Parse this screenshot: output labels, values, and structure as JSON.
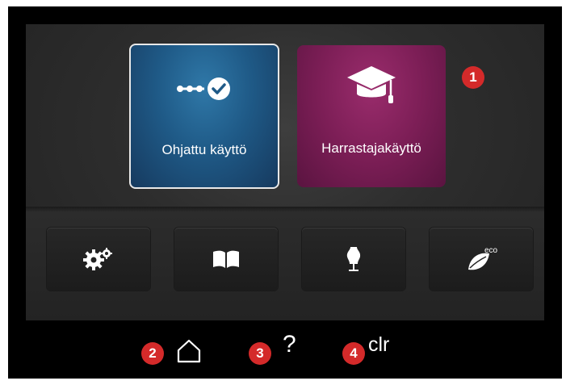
{
  "home": {
    "tiles": [
      {
        "label": "Ohjattu käyttö",
        "icon": "guided-path-check-icon",
        "selected": true
      },
      {
        "label": "Harrastajakäyttö",
        "icon": "graduation-cap-icon",
        "selected": false
      }
    ],
    "buttons": [
      {
        "icon": "settings-gears-icon"
      },
      {
        "icon": "book-icon"
      },
      {
        "icon": "dress-form-icon"
      },
      {
        "icon": "eco-leaf-icon",
        "text": "eco"
      }
    ]
  },
  "navbar": {
    "help_label": "?",
    "clr_label": "clr",
    "home_icon": "home-icon"
  },
  "callouts": [
    "1",
    "2",
    "3",
    "4"
  ],
  "colors": {
    "guided_tile": "#1f5a87",
    "creative_tile": "#7c1e56",
    "badge": "#d42a2a",
    "background": "#000000"
  }
}
